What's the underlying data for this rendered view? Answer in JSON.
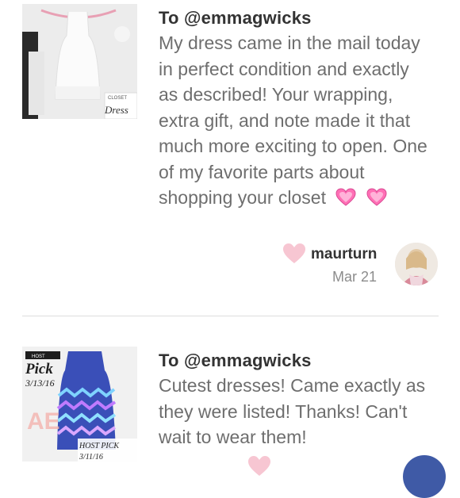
{
  "reviews": [
    {
      "to_label": "To @emmagwicks",
      "body": "My dress came in the mail today in perfect condition and exactly as described! Your wrapping, extra gift, and note made it that much more exciting to open. One of my favorite parts about shopping your closet",
      "emoji": "💗 💗",
      "username": "maurturn",
      "date": "Mar 21",
      "thumb_text": "Dress"
    },
    {
      "to_label": "To @emmagwicks",
      "body": "Cutest dresses! Came exactly as they were listed! Thanks! Can't wait to wear them!",
      "thumb_text": {
        "host": "HOST",
        "pick": "Pick",
        "date": "3/13/16",
        "host_pick": "HOST PICK",
        "host_pick_date": "3/11/16"
      }
    }
  ],
  "colors": {
    "heart_pink": "#f7c6d2",
    "emoji_pink": "#ff6fb5",
    "divider": "#dddddd"
  },
  "icons": {
    "like": "heart-icon",
    "emoji": "sparkling-heart-icon"
  }
}
